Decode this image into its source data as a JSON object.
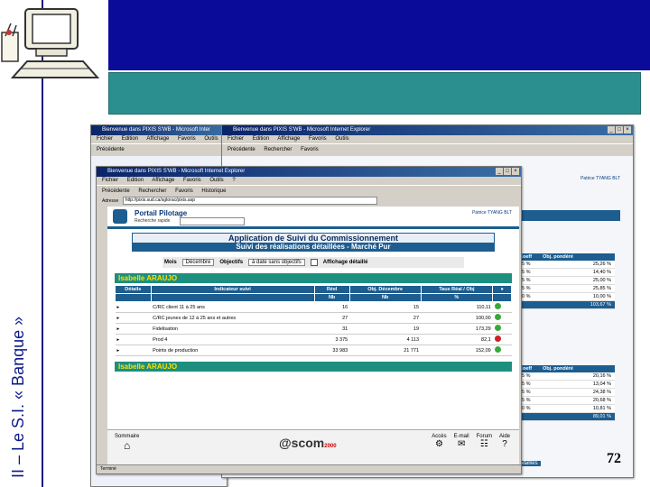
{
  "slide": {
    "vertical_title": "II – Le S.I. « Banque »",
    "page_number": "72",
    "colors": {
      "top_band": "#0b0b9a",
      "teal_band": "#2b8f8f",
      "title_text": "#0b1a8c"
    }
  },
  "windows": {
    "back_left": {
      "title": "Bienvenue dans PIXIS S'WB - Microsoft Inter",
      "menu": [
        "Fichier",
        "Edition",
        "Affichage",
        "Favoris",
        "Outils"
      ],
      "toolbar": [
        "Précédente"
      ]
    },
    "back_right": {
      "title": "Bienvenue dans PIXIS S'WB - Microsoft Internet Explorer",
      "menu": [
        "Fichier",
        "Edition",
        "Affichage",
        "Favoris",
        "Outils"
      ],
      "toolbar": [
        "Précédente",
        "Rechercher",
        "Favoris"
      ],
      "user": "Patrice TYANG BLT",
      "table": {
        "headers": [
          "Coeff",
          "Obj. pondéré"
        ],
        "rows": [
          [
            "25 %",
            "25,26 %"
          ],
          [
            "15 %",
            "14,40 %"
          ],
          [
            "25 %",
            "25,00 %"
          ],
          [
            "25 %",
            "25,85 %"
          ],
          [
            "10 %",
            "10,00 %"
          ],
          [
            "",
            "103,67 %"
          ]
        ],
        "rows2": [
          [
            "25 %",
            "20,16 %"
          ],
          [
            "15 %",
            "13,04 %"
          ],
          [
            "25 %",
            "24,38 %"
          ],
          [
            "25 %",
            "20,68 %"
          ],
          [
            "10 %",
            "10,81 %"
          ],
          [
            "",
            "89,01 %"
          ]
        ],
        "links": [
          "Vailliés",
          "Vailliés"
        ]
      }
    },
    "front": {
      "title": "Bienvenue dans PIXIS S'WB - Microsoft Internet Explorer",
      "menu": [
        "Fichier",
        "Edition",
        "Affichage",
        "Favoris",
        "Outils",
        "?"
      ],
      "toolbar": [
        "Précédente",
        "Rechercher",
        "Favoris",
        "Historique"
      ],
      "address_label": "Adresse",
      "address": "http://pixis.sud.ca/sgtorac/pixis.asp",
      "portal_title": "Portail Pilotage",
      "quick_search": "Recherche rapide",
      "user": "Patrice TYANG BLT",
      "app_title": "Application de Suivi du Commissionnement",
      "app_subtitle": "Suivi des réalisations détaillées - Marché Pur",
      "filters": {
        "mois_label": "Mois",
        "mois_value": "Décembre",
        "objectifs_label": "Objectifs",
        "objectifs_value": "à date sans objectifs",
        "detail_label": "Affichage détaillé"
      },
      "section1": "Isabelle ARAUJO",
      "section2": "Isabelle ARAUJO",
      "table_headers": [
        "Détails",
        "Indicateur suivi",
        "Réel",
        "Obj. Décembre",
        "Taux Réal / Obj"
      ],
      "table_subheaders": [
        "Nb",
        "Nb",
        "%"
      ],
      "rows": [
        {
          "label": "C/RC client 11 à 25 ans",
          "reel": "16",
          "obj": "15",
          "taux": "110,11"
        },
        {
          "label": "C/RC jeunes de 12 à 25 ans et autres",
          "reel": "27",
          "obj": "27",
          "taux": "100,00"
        },
        {
          "label": "Fidelisation",
          "reel": "31",
          "obj": "19",
          "taux": "173,29"
        },
        {
          "label": "Prod 4",
          "reel": "3 375",
          "obj": "4 113",
          "taux": "82,1"
        },
        {
          "label": "Points de production",
          "reel": "33 983",
          "obj": "21 771",
          "taux": "152,09"
        }
      ],
      "bottom_left": "Sommaire",
      "bottom_icons": [
        "Accès",
        "E-mail",
        "Forum",
        "Aide"
      ],
      "logo_text": "scom",
      "logo_suffix": "2000",
      "status": "Terminé"
    }
  }
}
